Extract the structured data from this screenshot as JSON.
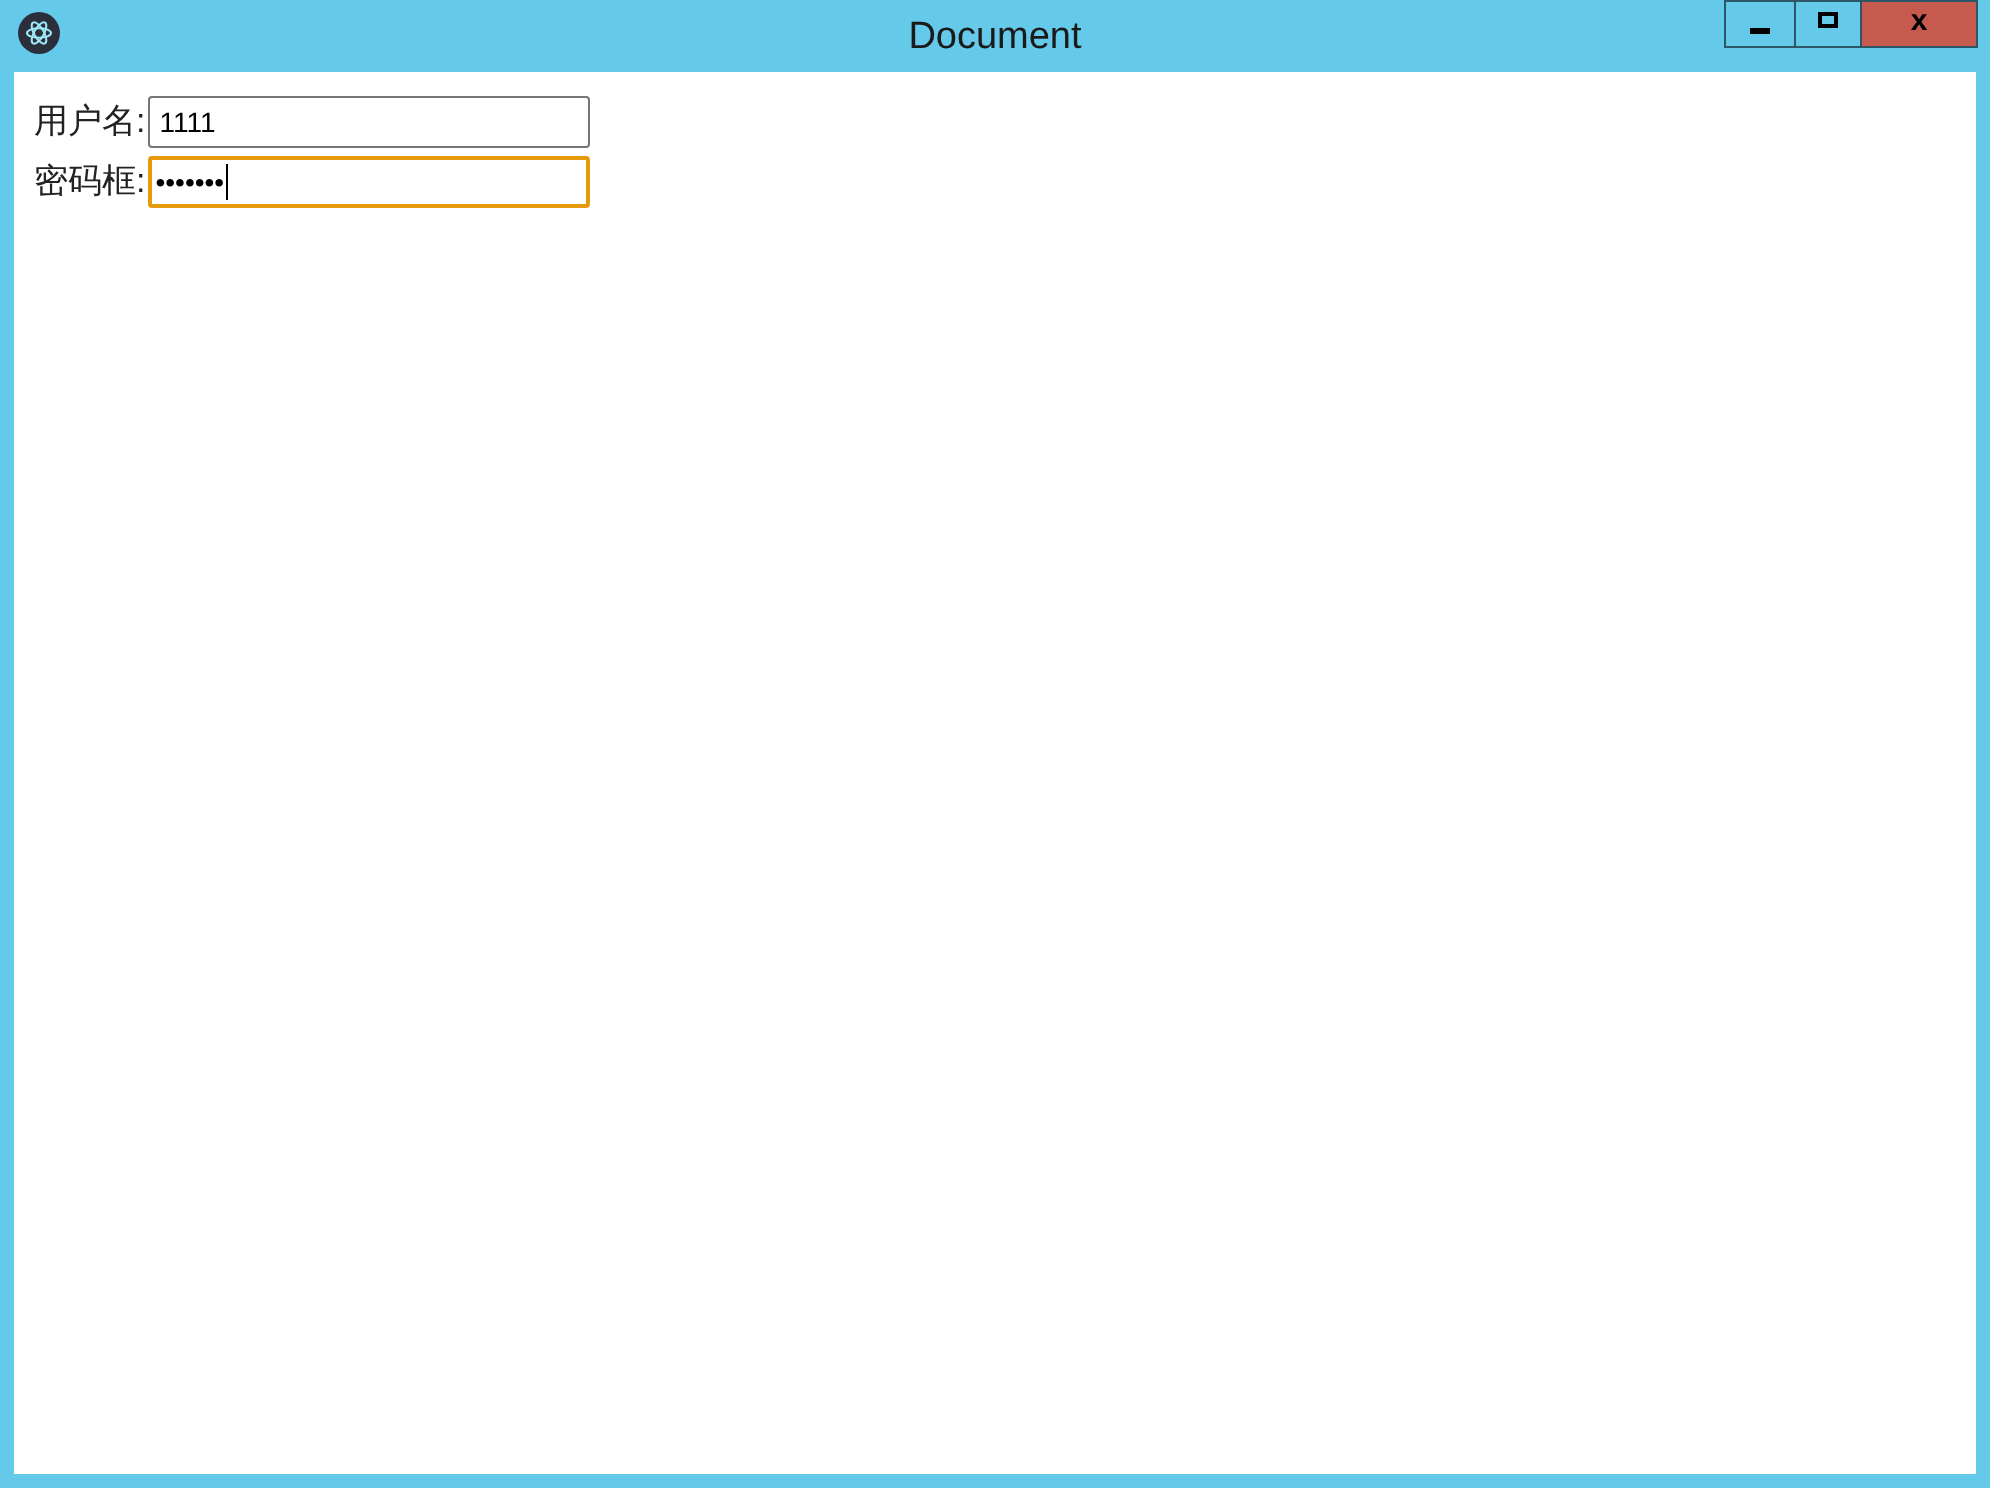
{
  "window": {
    "title": "Document",
    "close_label": "x"
  },
  "username_field": {
    "label": "用户名:",
    "value": "1111",
    "focused": false
  },
  "password_field": {
    "label": "密码框:",
    "masked_value": "•••••••",
    "focused": true
  }
}
